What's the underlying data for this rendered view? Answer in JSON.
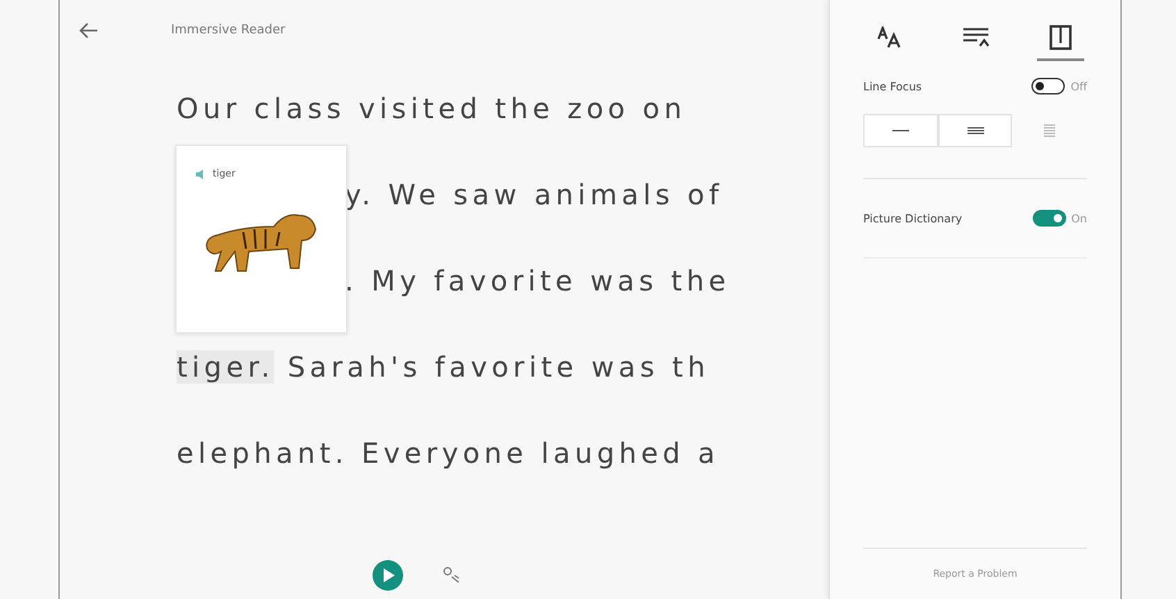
{
  "header": {
    "title": "Immersive Reader"
  },
  "lines": [
    {
      "text": "Our class visited the zoo on",
      "indent": false
    },
    {
      "text": "y. We saw animals of",
      "indent": true
    },
    {
      "text": ". My favorite was the",
      "indent": true
    },
    {
      "indent": false,
      "highlight": "tiger.",
      "rest": " Sarah's favorite was th"
    },
    {
      "text": "elephant. Everyone laughed a",
      "indent": false
    }
  ],
  "popup": {
    "word": "tiger"
  },
  "panel": {
    "tabs": [
      {
        "kind": "text",
        "selected": false
      },
      {
        "kind": "grammar",
        "selected": false
      },
      {
        "kind": "reading",
        "selected": true
      }
    ],
    "line_focus": {
      "label": "Line Focus",
      "on": false,
      "state": "Off"
    },
    "picture_dictionary": {
      "label": "Picture Dictionary",
      "on": true,
      "state": "On"
    },
    "report": "Report a Problem"
  }
}
